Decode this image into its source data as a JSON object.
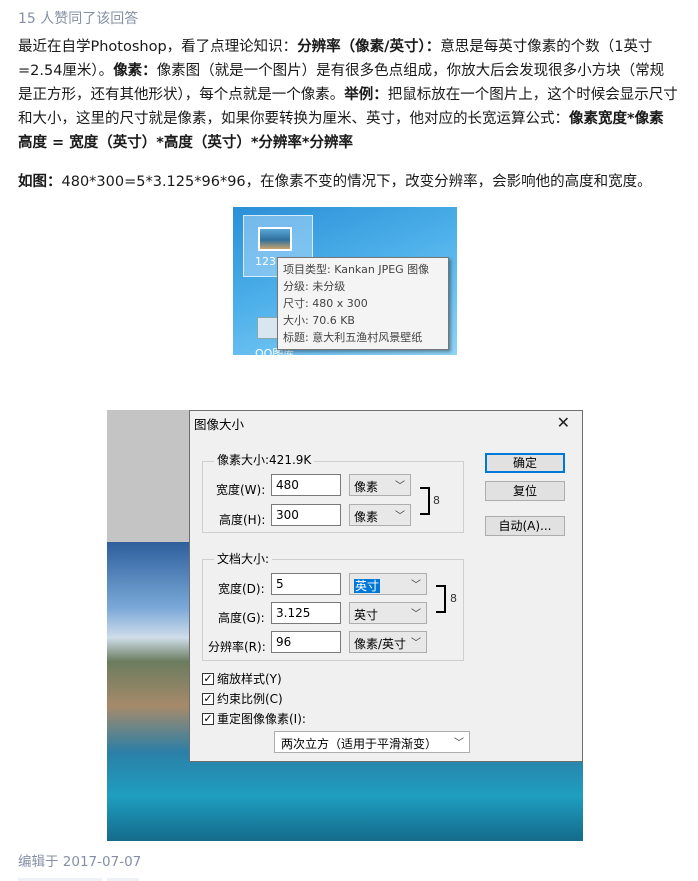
{
  "likes": "15 人赞同了该回答",
  "para1": {
    "t1": "最近在自学Photoshop，看了点理论知识：",
    "b1": "分辨率（像素/英寸）：",
    "t2": "意思是每英寸像素的个数（1英寸=2.54厘米）。",
    "b2": "像素：",
    "t3": "像素图（就是一个图片）是有很多色点组成，你放大后会发现很多小方块（常规是正方形，还有其他形状），每个点就是一个像素。",
    "b3": "举例：",
    "t4": "把鼠标放在一个图片上，这个时候会显示尺寸和大小，这里的尺寸就是像素，如果你要转换为厘米、英寸，他对应的长宽运算公式：",
    "b4": "像素宽度*像素高度 = 宽度（英寸）*高度（英寸）*分辨率*分辨率"
  },
  "para2": {
    "b1": "如图：",
    "t1": "480*300=5*3.125*96*96，在像素不变的情况下，改变分辨率，会影响他的高度和宽度。"
  },
  "explorer": {
    "file_name": "123",
    "qq_name": "QQ图库",
    "tooltip": [
      "项目类型: Kankan JPEG 图像",
      "分级: 未分级",
      "尺寸: 480 x 300",
      "大小: 70.6 KB",
      "标题: 意大利五渔村风景壁纸"
    ]
  },
  "dialog": {
    "title": "图像大小",
    "close": "✕",
    "pixel_group": "像素大小:421.9K",
    "width_label": "宽度(W):",
    "width_value": "480",
    "width_unit": "像素",
    "height_label": "高度(H):",
    "height_value": "300",
    "height_unit": "像素",
    "doc_group": "文档大小:",
    "doc_width_label": "宽度(D):",
    "doc_width_value": "5",
    "doc_width_unit": "英寸",
    "doc_height_label": "高度(G):",
    "doc_height_value": "3.125",
    "doc_height_unit": "英寸",
    "res_label": "分辨率(R):",
    "res_value": "96",
    "res_unit": "像素/英寸",
    "btn_ok": "确定",
    "btn_reset": "复位",
    "btn_auto": "自动(A)...",
    "chk_scale": "缩放样式(Y)",
    "chk_constrain": "约束比例(C)",
    "chk_resample": "重定图像像素(I):",
    "resample_method": "两次立方（适用于平滑渐变）",
    "check_mark": "✓",
    "chain_glyph": "8"
  },
  "edited": "编辑于 2017-07-07"
}
